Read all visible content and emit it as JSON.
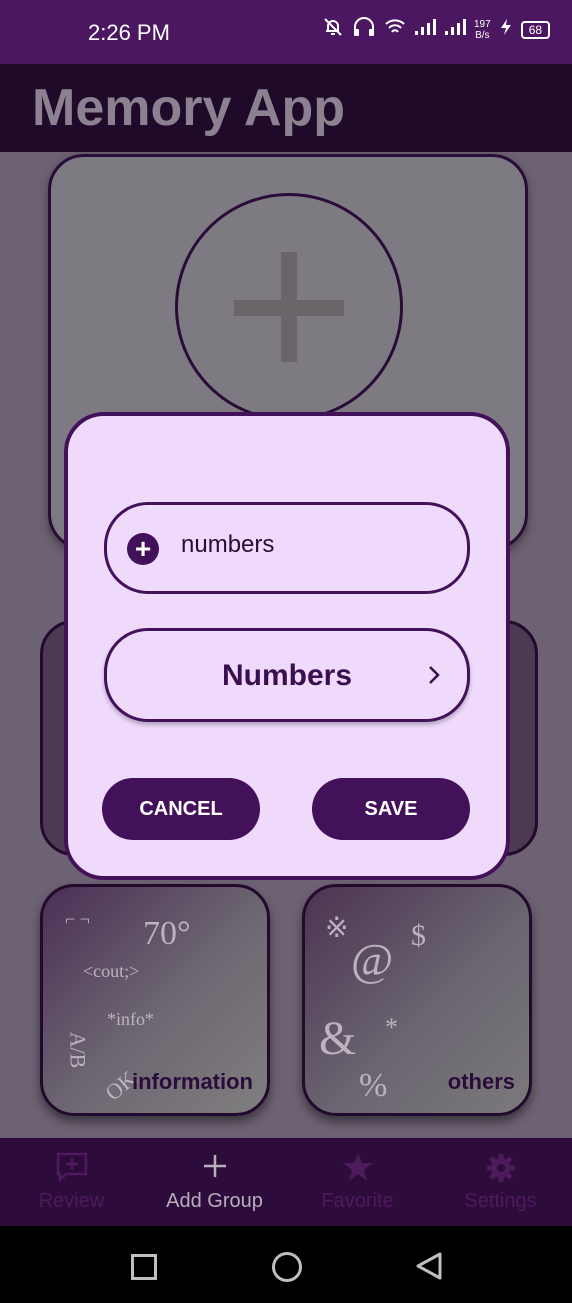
{
  "status_bar": {
    "time": "2:26 PM",
    "net_speed_value": "197",
    "net_speed_unit": "B/s",
    "battery": "68",
    "icons": [
      "bell-off-icon",
      "headset-icon",
      "wifi-icon",
      "signal-icon",
      "signal-icon",
      "charging-icon",
      "battery-icon"
    ]
  },
  "app": {
    "title": "Memory App"
  },
  "groups": [
    {
      "label": "information",
      "deco": [
        "70°",
        "<cout;>",
        "*info*",
        "A/B",
        "OK",
        "⌐ ¬"
      ]
    },
    {
      "label": "others",
      "deco": [
        "※",
        "@",
        "$",
        "&",
        "*",
        "%"
      ]
    }
  ],
  "dialog": {
    "input_value": "numbers",
    "selected_type": "Numbers",
    "cancel_label": "CANCEL",
    "save_label": "SAVE"
  },
  "bottom_nav": [
    {
      "label": "Review",
      "icon": "review-icon",
      "active": false
    },
    {
      "label": "Add Group",
      "icon": "plus-icon",
      "active": true
    },
    {
      "label": "Favorite",
      "icon": "star-icon",
      "active": false
    },
    {
      "label": "Settings",
      "icon": "gear-icon",
      "active": false
    }
  ],
  "colors": {
    "primary": "#43115a",
    "dialog_bg": "#efdafc",
    "status_bar": "#4b1760",
    "app_bar": "#1f0b29"
  }
}
